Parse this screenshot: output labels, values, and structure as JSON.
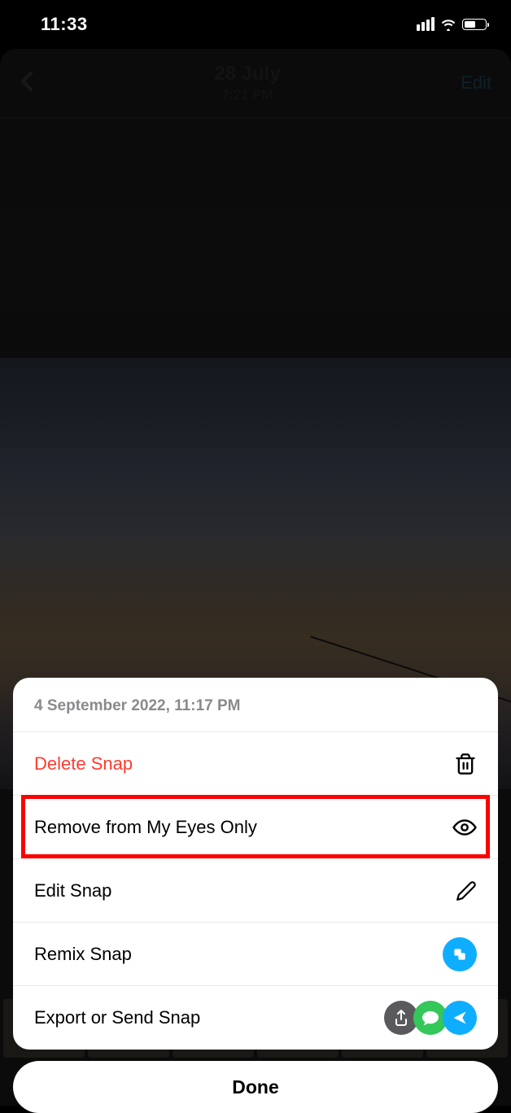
{
  "status": {
    "time": "11:33"
  },
  "header": {
    "date": "28 July",
    "time": "7:21 PM",
    "edit": "Edit"
  },
  "sheet": {
    "title": "4 September 2022, 11:17 PM",
    "rows": {
      "delete": "Delete Snap",
      "remove": "Remove from My Eyes Only",
      "edit": "Edit Snap",
      "remix": "Remix Snap",
      "export": "Export or Send Snap"
    }
  },
  "done": "Done"
}
